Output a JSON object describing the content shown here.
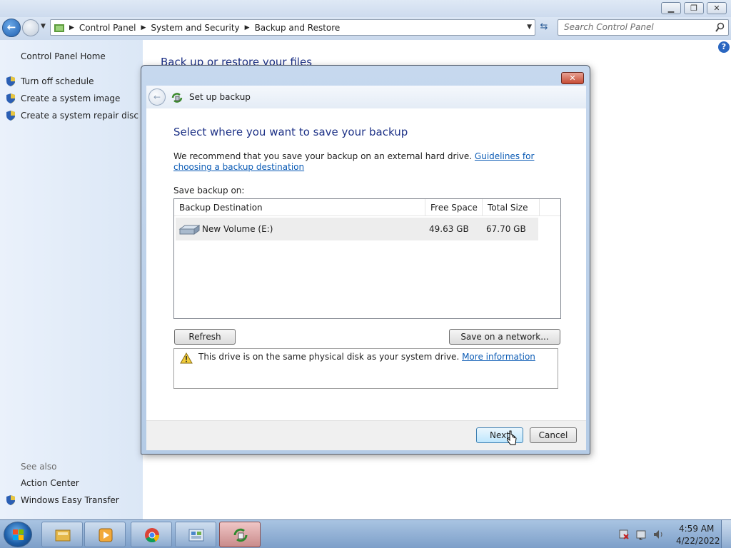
{
  "window": {
    "minimize_icon": "minimize-icon",
    "maximize_icon": "restore-icon",
    "close_icon": "close-icon"
  },
  "address_bar": {
    "crumbs": [
      "Control Panel",
      "System and Security",
      "Backup and Restore"
    ]
  },
  "search": {
    "placeholder": "Search Control Panel"
  },
  "left_pane": {
    "home_label": "Control Panel Home",
    "tasks": [
      "Turn off schedule",
      "Create a system image",
      "Create a system repair disc"
    ],
    "see_also_label": "See also",
    "see_also_items": [
      "Action Center",
      "Windows Easy Transfer"
    ]
  },
  "main": {
    "title": "Back up or restore your files"
  },
  "dialog": {
    "title": "Set up backup",
    "heading": "Select where you want to save your backup",
    "recommend_text": "We recommend that you save your backup on an external hard drive. ",
    "guidelines_link": "Guidelines for choosing a backup destination",
    "save_on_label": "Save backup on:",
    "columns": [
      "Backup Destination",
      "Free Space",
      "Total Size"
    ],
    "rows": [
      {
        "name": "New Volume (E:)",
        "free": "49.63 GB",
        "total": "67.70 GB"
      }
    ],
    "refresh_label": "Refresh",
    "network_label": "Save on a network...",
    "warning_text": "This drive is on the same physical disk as your system drive. ",
    "more_info_link": "More information",
    "next_label": "Next",
    "cancel_label": "Cancel"
  },
  "taskbar": {
    "apps": [
      "windows-explorer",
      "windows-media-player",
      "google-chrome",
      "control-panel",
      "backup-and-restore"
    ],
    "time": "4:59 AM",
    "date": "4/22/2022"
  },
  "colors": {
    "accent_heading": "#1e3287",
    "link": "#0b5bb5"
  }
}
